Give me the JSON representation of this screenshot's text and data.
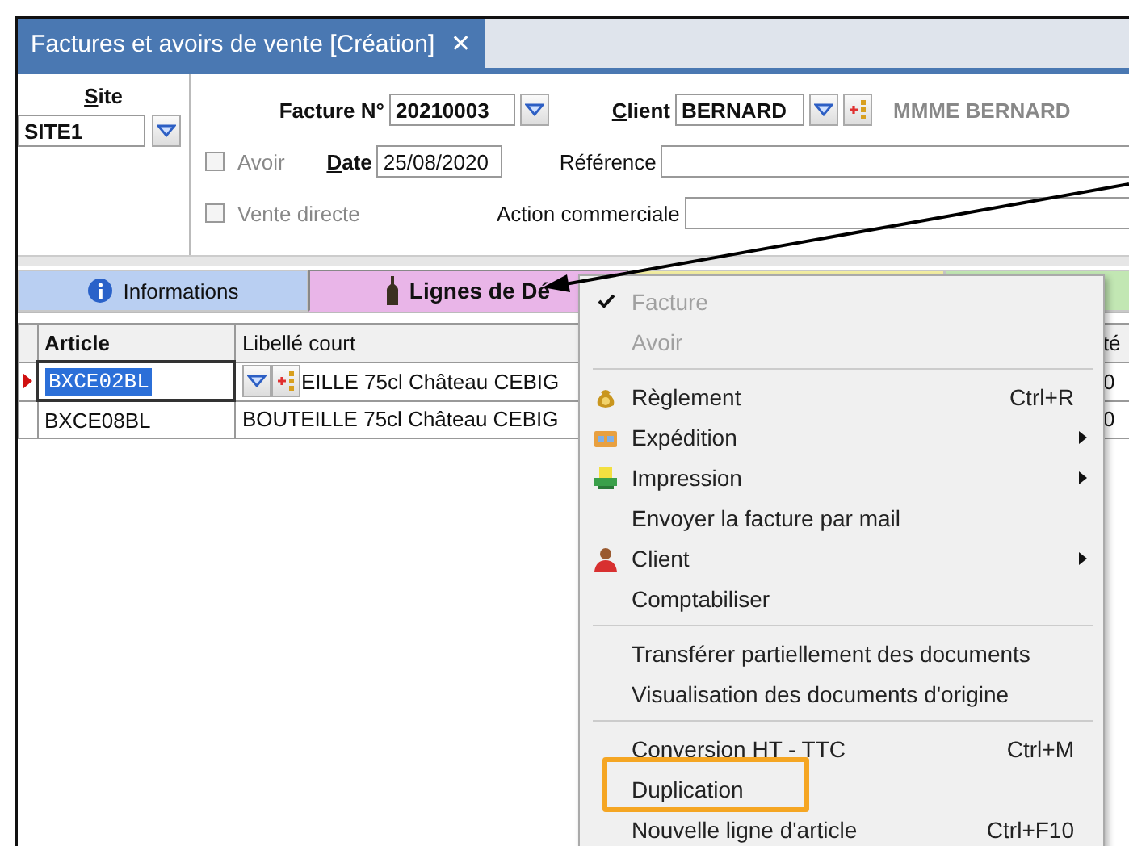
{
  "window": {
    "title": "Factures et avoirs de vente [Création]",
    "close": "✕"
  },
  "site": {
    "label": "Site",
    "value": "SITE1"
  },
  "form": {
    "facture_label": "Facture N°",
    "facture_value": "20210003",
    "client_label": "Client",
    "client_value": "BERNARD",
    "client_name": "MMME BERNARD",
    "avoir": {
      "label": "Avoir",
      "checked": false,
      "disabled": true
    },
    "date_label": "Date",
    "date_value": "25/08/2020",
    "reference_label": "Référence",
    "vente_directe": {
      "label": "Vente directe",
      "checked": false,
      "disabled": true
    },
    "action_label": "Action commerciale"
  },
  "tabs": [
    {
      "label": "Informations",
      "selected": false,
      "color": "#b9cff2"
    },
    {
      "label": "Lignes de Dé",
      "selected": true,
      "color": "#e9b5e8"
    },
    {
      "selected": false,
      "color": "#f4efa3"
    },
    {
      "selected": false,
      "color": "#c2e7b3"
    }
  ],
  "table": {
    "columns": [
      "Article",
      "Libellé court",
      "té"
    ],
    "rows": [
      {
        "selected": true,
        "cells": [
          "BXCE02BL",
          "EILLE 75cl  Château CEBIG",
          "0"
        ]
      },
      {
        "selected": false,
        "cells": [
          "BXCE08BL",
          "BOUTEILLE 75cl  Château CEBIG",
          "0"
        ]
      }
    ]
  },
  "context_menu": [
    {
      "kind": "item",
      "label": "Facture",
      "checked": true,
      "disabled": true
    },
    {
      "kind": "item",
      "label": "Avoir",
      "checked": false,
      "disabled": true
    },
    {
      "kind": "separator"
    },
    {
      "kind": "item",
      "label": "Règlement",
      "shortcut": "Ctrl+R",
      "checked": false,
      "disabled": false
    },
    {
      "kind": "item",
      "label": "Expédition",
      "submenu": true,
      "checked": false,
      "disabled": false
    },
    {
      "kind": "item",
      "label": "Impression",
      "submenu": true,
      "checked": false,
      "disabled": false
    },
    {
      "kind": "item",
      "label": "Envoyer la facture  par mail",
      "checked": false,
      "disabled": false
    },
    {
      "kind": "item",
      "label": "Client",
      "submenu": true,
      "checked": false,
      "disabled": false
    },
    {
      "kind": "item",
      "label": "Comptabiliser",
      "checked": false,
      "disabled": false
    },
    {
      "kind": "separator"
    },
    {
      "kind": "item",
      "label": "Transférer partiellement des documents",
      "checked": false,
      "disabled": false
    },
    {
      "kind": "item",
      "label": "Visualisation des documents d'origine",
      "checked": false,
      "disabled": false
    },
    {
      "kind": "separator"
    },
    {
      "kind": "item",
      "label": "Conversion HT - TTC",
      "shortcut": "Ctrl+M",
      "checked": false,
      "disabled": false
    },
    {
      "kind": "item",
      "label": "Duplication",
      "highlighted": true,
      "checked": false,
      "disabled": false
    },
    {
      "kind": "item",
      "label": "Nouvelle ligne d'article",
      "shortcut": "Ctrl+F10",
      "checked": false,
      "disabled": false
    }
  ]
}
